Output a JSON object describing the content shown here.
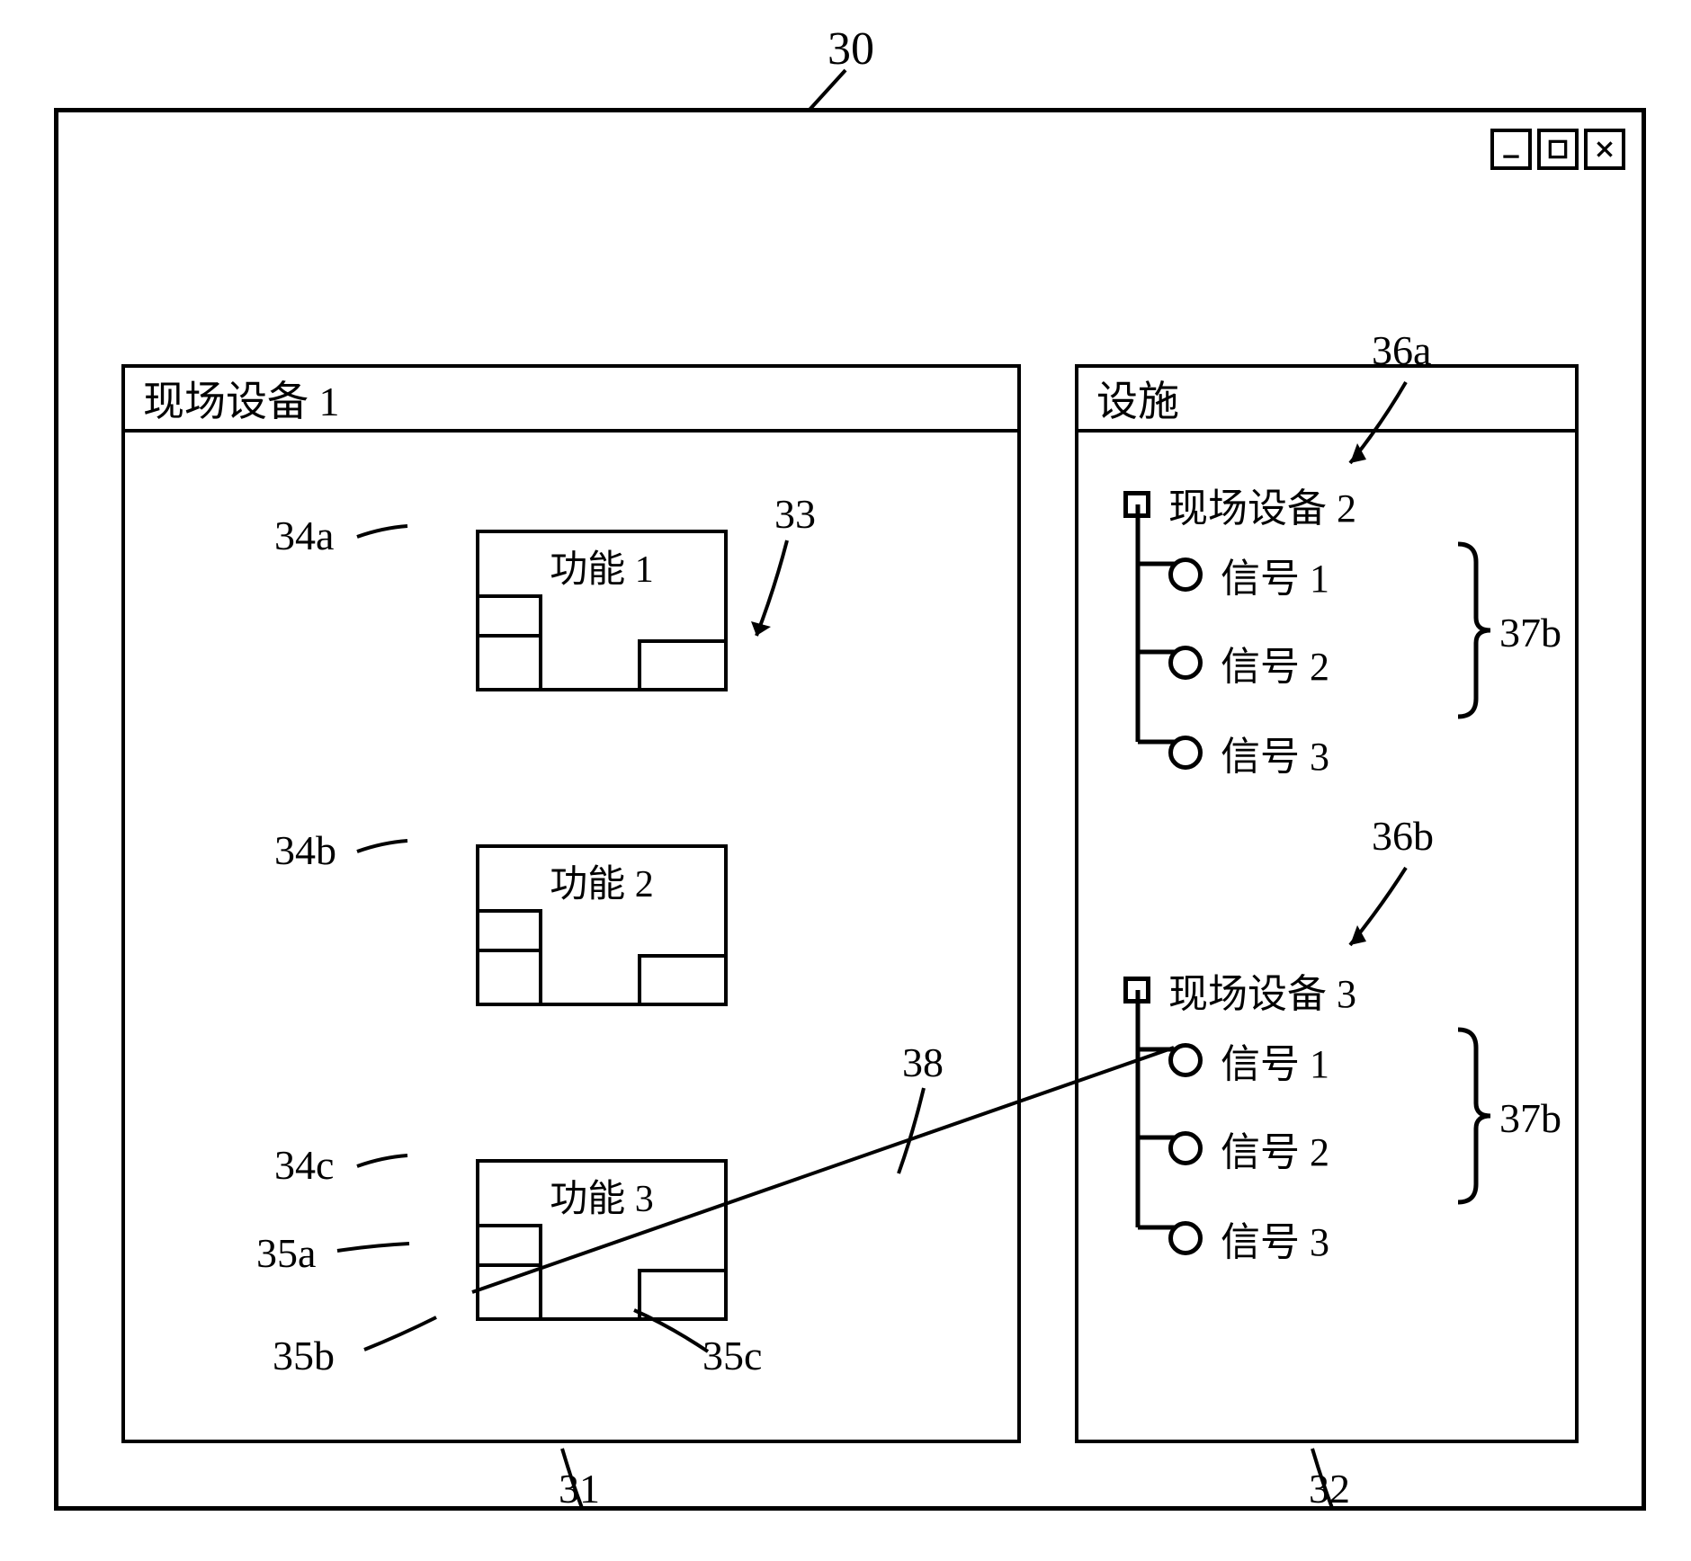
{
  "chart_data": {
    "type": "diagram",
    "title": "",
    "description": "Software configuration window containing a device editor panel (left) and a facility tree panel (right). Reference numerals annotate the window and its parts.",
    "window": {
      "ref": "30",
      "controls": [
        "minimize",
        "maximize",
        "close"
      ]
    },
    "left_panel": {
      "ref": "31",
      "title": "现场设备 1",
      "content_area_ref": "33",
      "functions": [
        {
          "ref": "34a",
          "label": "功能 1",
          "ports": [
            "35a",
            "35b",
            "35c"
          ]
        },
        {
          "ref": "34b",
          "label": "功能 2",
          "ports": [
            "35a",
            "35b",
            "35c"
          ]
        },
        {
          "ref": "34c",
          "label": "功能 3",
          "ports": [
            "35a",
            "35b",
            "35c"
          ]
        }
      ],
      "port_refs_shown_on_function3": [
        "35a",
        "35b",
        "35c"
      ]
    },
    "right_panel": {
      "ref": "32",
      "title": "设施",
      "devices": [
        {
          "ref": "36a",
          "label": "现场设备 2",
          "signals": [
            "信号 1",
            "信号 2",
            "信号 3"
          ],
          "signals_group_ref": "37b"
        },
        {
          "ref": "36b",
          "label": "现场设备 3",
          "signals": [
            "信号 1",
            "信号 2",
            "信号 3"
          ],
          "signals_group_ref": "37b"
        }
      ]
    },
    "connection_line": {
      "ref": "38",
      "from": "function 3 port 35b (left panel)",
      "to": "现场设备 3 / 信号 1 (right panel)"
    }
  },
  "ui": {
    "window_ref": "30",
    "left_panel_ref": "31",
    "right_panel_ref": "32",
    "content_area_ref": "33",
    "connection_ref": "38",
    "left_title": "现场设备 1",
    "right_title": "设施",
    "func1_ref": "34a",
    "func2_ref": "34b",
    "func3_ref": "34c",
    "func1_label": "功能 1",
    "func2_label": "功能 2",
    "func3_label": "功能 3",
    "port_a_ref": "35a",
    "port_b_ref": "35b",
    "port_c_ref": "35c",
    "dev2_ref": "36a",
    "dev3_ref": "36b",
    "dev2_label": "现场设备 2",
    "dev3_label": "现场设备 3",
    "sig1": "信号 1",
    "sig2": "信号 2",
    "sig3": "信号 3",
    "siggroup_ref": "37b"
  }
}
